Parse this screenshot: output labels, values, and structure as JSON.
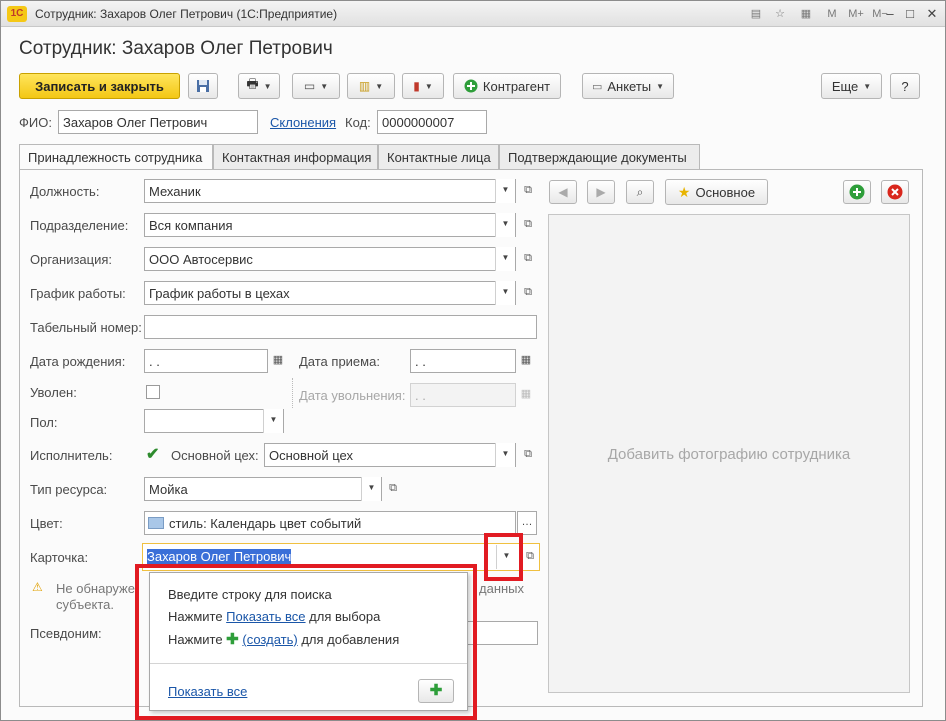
{
  "window": {
    "title": "Сотрудник: Захаров Олег Петрович  (1С:Предприятие)",
    "logo": "1С",
    "controls": {
      "m": "M",
      "mplus": "M+",
      "mminus": "M−",
      "minimize": "–",
      "maximize": "□",
      "close": "✕"
    }
  },
  "form": {
    "title": "Сотрудник: Захаров Олег Петрович"
  },
  "toolbar": {
    "save_close": "Записать и закрыть",
    "counterparty": "Контрагент",
    "profiles": "Анкеты",
    "more": "Еще",
    "help": "?"
  },
  "header_fields": {
    "fio_label": "ФИО:",
    "fio_value": "Захаров Олег Петрович",
    "declensions_link": "Склонения",
    "code_label": "Код:",
    "code_value": "0000000007"
  },
  "tabs": [
    {
      "label": "Принадлежность сотрудника",
      "active": true
    },
    {
      "label": "Контактная информация"
    },
    {
      "label": "Контактные лица"
    },
    {
      "label": "Подтверждающие документы"
    }
  ],
  "fields": {
    "position_label": "Должность:",
    "position_value": "Механик",
    "department_label": "Подразделение:",
    "department_value": "Вся компания",
    "organization_label": "Организация:",
    "organization_value": "ООО Автосервис",
    "schedule_label": "График работы:",
    "schedule_value": "График работы в цехах",
    "tab_number_label": "Табельный номер:",
    "tab_number_value": "",
    "birth_date_label": "Дата рождения:",
    "birth_date_value": "  .  .",
    "hire_date_label": "Дата приема:",
    "hire_date_value": "  .  .",
    "fired_label": "Уволен:",
    "dismissal_date_label": "Дата увольнения:",
    "dismissal_date_value": "  .  .",
    "gender_label": "Пол:",
    "gender_value": "",
    "performer_label": "Исполнитель:",
    "main_shop_label": "Основной цех:",
    "main_shop_value": "Основной цех",
    "resource_type_label": "Тип ресурса:",
    "resource_type_value": "Мойка",
    "color_label": "Цвет:",
    "color_value": "стиль: Календарь цвет событий",
    "card_label": "Карточка:",
    "card_value": "Захаров Олег Петрович",
    "warning_part1": "Не обнаруже",
    "warning_part2": "данных",
    "warning_part3": "субъекта.",
    "alias_label": "Псевдоним:"
  },
  "photo": {
    "main_button": "Основное",
    "placeholder": "Добавить фотографию сотрудника"
  },
  "popup": {
    "line1": "Введите строку для поиска",
    "line2_prefix": "Нажмите ",
    "line2_link": "Показать все",
    "line2_suffix": " для выбора",
    "line3_prefix": "Нажмите ",
    "line3_link": "(создать)",
    "line3_suffix": " для добавления",
    "show_all": "Показать все"
  },
  "colors": {
    "accent_yellow": "#f3c714",
    "highlight_red": "#e11b22",
    "link_blue": "#1a56a8",
    "selection_blue": "#3a6fd8",
    "add_green": "#2e9e3a",
    "delete_red": "#d9261c"
  },
  "icons": [
    "printer-icon",
    "save-icon",
    "star-icon",
    "search-icon",
    "plus-icon",
    "close-icon",
    "arrow-left-icon",
    "arrow-right-icon",
    "calendar-icon",
    "warning-icon",
    "open-icon"
  ]
}
